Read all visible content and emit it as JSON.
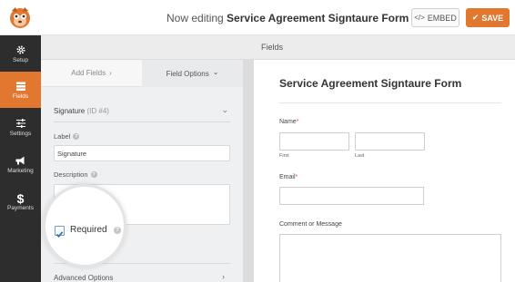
{
  "header": {
    "editing_prefix": "Now editing",
    "form_name": "Service Agreement Signtaure Form",
    "embed_label": "EMBED",
    "save_label": "SAVE",
    "brand_color": "#e27730"
  },
  "sidebar": {
    "items": [
      {
        "label": "Setup",
        "icon": "gear-icon"
      },
      {
        "label": "Fields",
        "icon": "fields-icon",
        "active": true
      },
      {
        "label": "Settings",
        "icon": "sliders-icon"
      },
      {
        "label": "Marketing",
        "icon": "megaphone-icon"
      },
      {
        "label": "Payments",
        "icon": "dollar-icon"
      }
    ]
  },
  "fields_bar": {
    "title": "Fields"
  },
  "panel": {
    "tab_add": "Add Fields",
    "tab_add_arrow": "›",
    "tab_options": "Field Options",
    "tab_options_arrow": "⌄",
    "field_name": "Signature",
    "field_id": "(ID #4)",
    "label_caption": "Label",
    "label_value": "Signature",
    "description_caption": "Description",
    "required_label": "Required",
    "advanced_label": "Advanced Options"
  },
  "preview": {
    "form_title": "Service Agreement Signtaure Form",
    "name_label": "Name",
    "first_label": "First",
    "last_label": "Last",
    "email_label": "Email",
    "comment_label": "Comment or Message",
    "required_mark": "*"
  }
}
